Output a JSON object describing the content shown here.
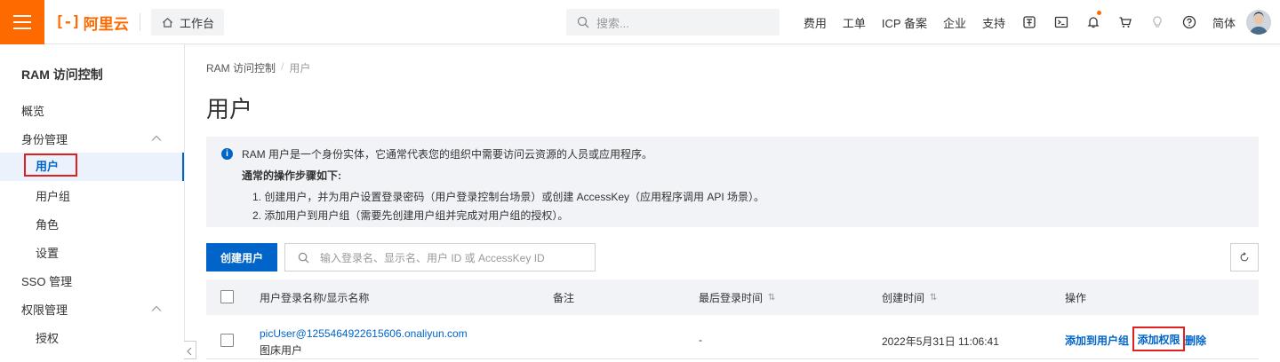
{
  "topbar": {
    "logo_mark": "[-]",
    "logo_text": "阿里云",
    "workbench": "工作台",
    "search_placeholder": "搜索...",
    "nav": [
      "费用",
      "工单",
      "ICP 备案",
      "企业",
      "支持"
    ],
    "lang": "简体"
  },
  "sidebar": {
    "title": "RAM 访问控制",
    "items": [
      {
        "label": "概览"
      },
      {
        "label": "身份管理"
      },
      {
        "label": "用户"
      },
      {
        "label": "用户组"
      },
      {
        "label": "角色"
      },
      {
        "label": "设置"
      },
      {
        "label": "SSO 管理"
      },
      {
        "label": "权限管理"
      },
      {
        "label": "授权"
      }
    ]
  },
  "breadcrumb": {
    "root": "RAM 访问控制",
    "sep": "/",
    "current": "用户"
  },
  "page_title": "用户",
  "notice": {
    "line1": "RAM 用户是一个身份实体，它通常代表您的组织中需要访问云资源的人员或应用程序。",
    "line2": "通常的操作步骤如下:",
    "line3": "1. 创建用户，并为用户设置登录密码（用户登录控制台场景）或创建 AccessKey（应用程序调用 API 场景）。",
    "line4": "2. 添加用户到用户组（需要先创建用户组并完成对用户组的授权）。"
  },
  "toolbar": {
    "create_label": "创建用户",
    "search_placeholder": "输入登录名、显示名、用户 ID 或 AccessKey ID"
  },
  "table": {
    "columns": [
      "用户登录名称/显示名称",
      "备注",
      "最后登录时间",
      "创建时间",
      "操作"
    ],
    "sort_glyph": "⇅",
    "rows": [
      {
        "login_name": "picUser@1255464922615606.onaliyun.com",
        "display_name": "图床用户",
        "note": "",
        "last_login": "-",
        "created": "2022年5月31日 11:06:41",
        "actions": [
          "添加到用户组",
          "添加权限",
          "删除"
        ]
      }
    ]
  },
  "colors": {
    "accent": "#ff6a00",
    "primary": "#0064c8",
    "highlight_box": "#e02020"
  }
}
